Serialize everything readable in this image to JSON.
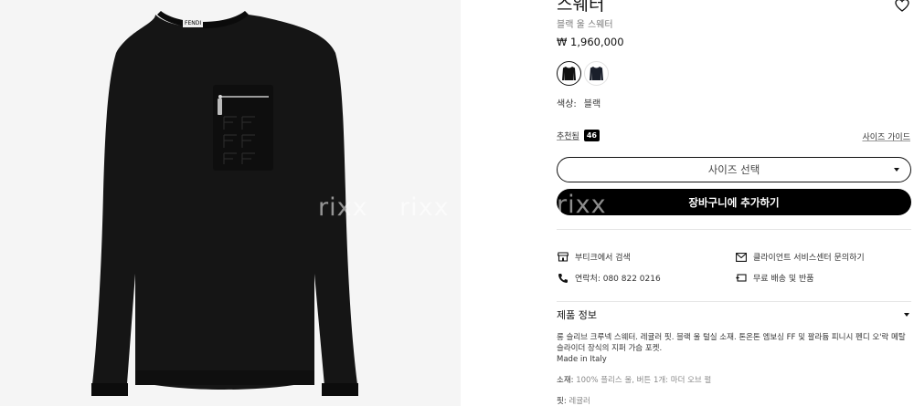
{
  "product": {
    "title": "스웨터",
    "subtitle": "블랙 울 스웨터",
    "price": "₩ 1,960,000"
  },
  "color": {
    "label": "색상:",
    "value": "블랙",
    "swatches": [
      {
        "name": "black",
        "selected": true,
        "hex": "#111111"
      },
      {
        "name": "navy",
        "selected": false,
        "hex": "#1a1f2b"
      }
    ]
  },
  "recommend": {
    "label": "추천됨",
    "count": "46"
  },
  "size_guide": "사이즈 가이드",
  "size_select": {
    "label": "사이즈 선택"
  },
  "cart_button": "장바구니에 추가하기",
  "watermark": {
    "a": "rixx",
    "b": "rixx",
    "c": "rixx"
  },
  "links": {
    "boutique": "부티크에서 검색",
    "client_service": "클라이언트 서비스센터 문의하기",
    "contact": "연락처: 080 822 0216",
    "shipping": "무료 배송 및 반품"
  },
  "details": {
    "heading": "제품 정보",
    "description": "롱 슬리브 크루넥 스웨터. 레귤러 핏. 블랙 울 털실 소재. 톤온톤 엠보싱 FF 및 팔라듐 피니시 펜디 오'락 메탈 슬라이더 장식의 지퍼 가슴 포켓.",
    "made_in": "Made in Italy",
    "material_label": "소재:",
    "material_value": "100% 플리스 울, 버튼 1개: 마더 오브 펄",
    "fit_label": "핏:",
    "fit_value": "레귤러"
  },
  "brand_label": "FENDI",
  "colors": {
    "accent": "#000000",
    "bg": "#ffffff",
    "gallery_bg": "#f5f5f5",
    "muted": "#7a7a7a"
  }
}
